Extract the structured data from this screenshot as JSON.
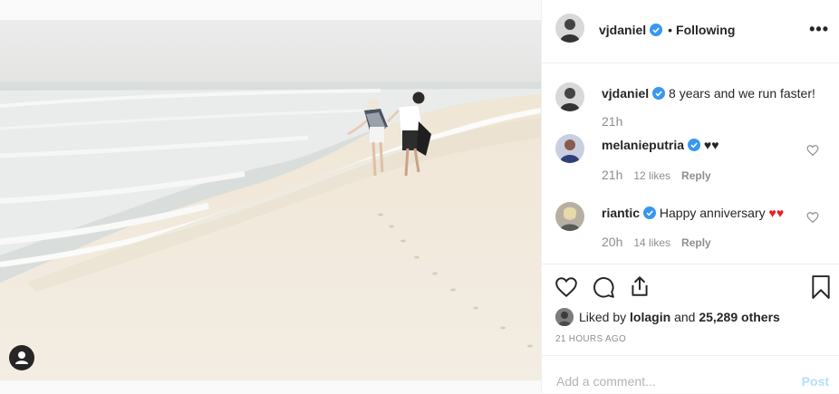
{
  "post": {
    "author": "vjdaniel",
    "follow_status": "Following",
    "separator": "•",
    "caption": "8 years and we run faster!",
    "caption_time": "21h"
  },
  "comments": [
    {
      "user": "melanieputria",
      "text": "♥♥",
      "time": "21h",
      "likes": "12 likes",
      "reply": "Reply"
    },
    {
      "user": "riantic",
      "text": "Happy anniversary",
      "text_emoji": "♥♥",
      "time": "20h",
      "likes": "14 likes",
      "reply": "Reply"
    }
  ],
  "likes": {
    "prefix": "Liked by",
    "user": "lolagin",
    "conjunction": "and",
    "count": "25,289 others"
  },
  "timestamp": "21 HOURS AGO",
  "comment_box": {
    "placeholder": "Add a comment...",
    "post_label": "Post"
  },
  "menu": {
    "more_label": "•••"
  },
  "colors": {
    "verified": "#3897f0",
    "post_disabled": "#b2dffc",
    "heart_red": "#ed1c24"
  },
  "icons": [
    "heart-icon",
    "comment-icon",
    "share-icon",
    "bookmark-icon",
    "verified-icon",
    "user-tag-icon",
    "more-icon"
  ]
}
